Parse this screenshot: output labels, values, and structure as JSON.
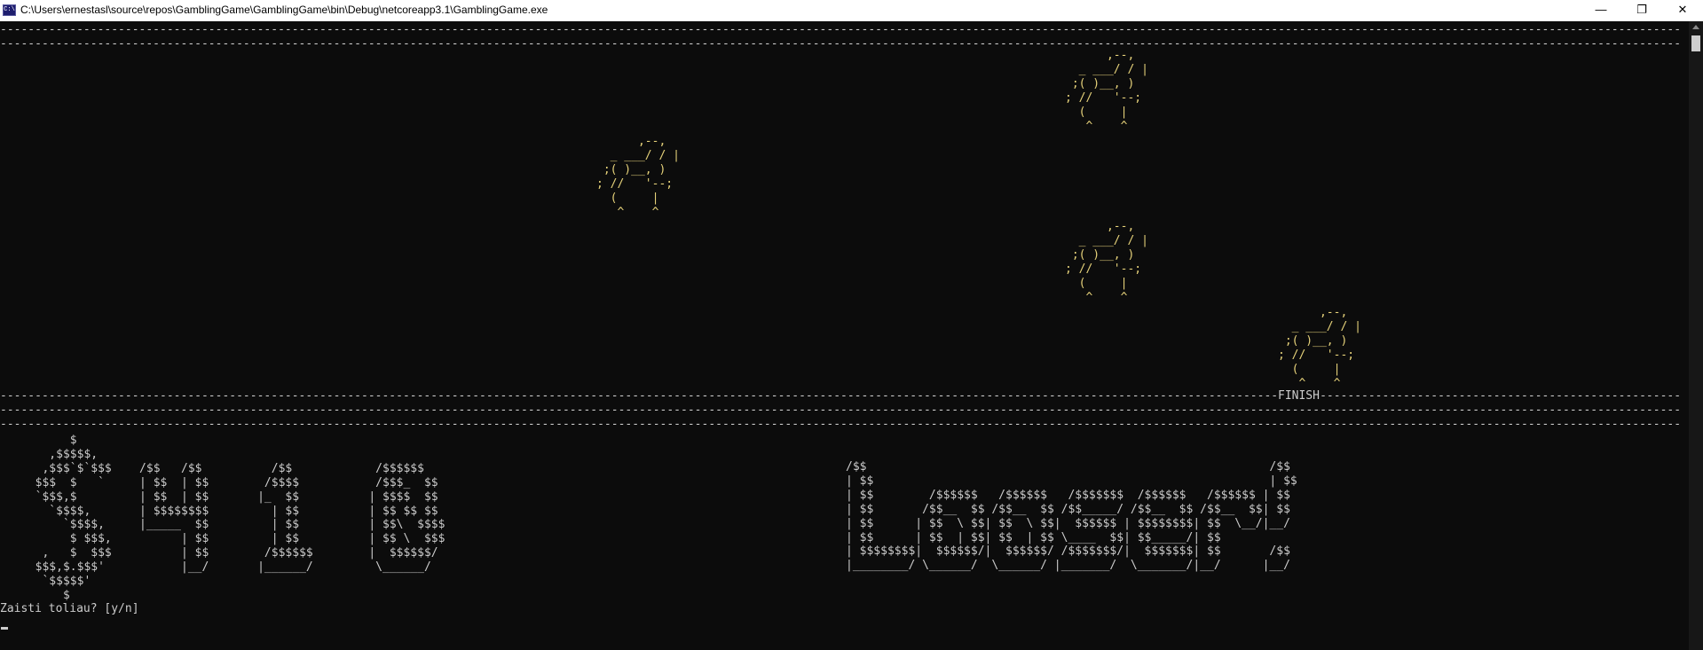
{
  "window": {
    "title": "C:\\Users\\ernestasl\\source\\repos\\GamblingGame\\GamblingGame\\bin\\Debug\\netcoreapp3.1\\GamblingGame.exe",
    "icon_text": "C:\\",
    "minimize_glyph": "—",
    "restore_glyph": "❐",
    "close_glyph": "✕"
  },
  "track": {
    "border": "----------------------------------------------------------------------------------------------------------------------------------------------------------------------------------------------------------------------------------------------------------------------------",
    "finish_label": "FINISH"
  },
  "horses": {
    "art": "      ,--,\n  _ ___/ / |\n ;( )__, )\n; //   '--;\n  (     |\n   ^    ^"
  },
  "banners": {
    "money": "       $\n    ,$$$$$,\n   ,$$$`$`$$$    /$$   /$$          /$$            /$$$$$$\n  $$$  $   `     | $$  | $$        /$$$$           /$$$_  $$\n  `$$$,$         | $$  | $$       |_  $$          | $$$$  $$\n    `$$$$,       | $$$$$$$$         | $$          | $$ $$ $$\n      `$$$$,     |_____  $$         | $$          | $$\\  $$$$\n       $ $$$,          | $$         | $$          | $$ \\  $$$\n   ,   $  $$$          | $$        /$$$$$$        |  $$$$$$/\n  $$$,$.$$$'           |__/       |______/         \\______/\n   `$$$$$'\n      $",
    "loser": "/$$                                                          /$$\n| $$                                                         | $$\n| $$        /$$$$$$   /$$$$$$   /$$$$$$$  /$$$$$$   /$$$$$$ | $$\n| $$       /$$__  $$ /$$__  $$ /$$_____/ /$$__  $$ /$$__  $$| $$\n| $$      | $$  \\ $$| $$  \\ $$|  $$$$$$ | $$$$$$$$| $$  \\__/|__/\n| $$      | $$  | $$| $$  | $$ \\____  $$| $$_____/| $$\n| $$$$$$$$|  $$$$$$/|  $$$$$$/ /$$$$$$$/|  $$$$$$$| $$       /$$\n|________/ \\______/  \\______/ |_______/  \\_______/|__/      |__/"
  },
  "prompt": {
    "text": "Zaisti toliau? [y/n]"
  },
  "colors": {
    "background": "#0c0c0c",
    "text": "#cccccc",
    "horse": "#e6d27a",
    "titlebar": "#ffffff"
  }
}
